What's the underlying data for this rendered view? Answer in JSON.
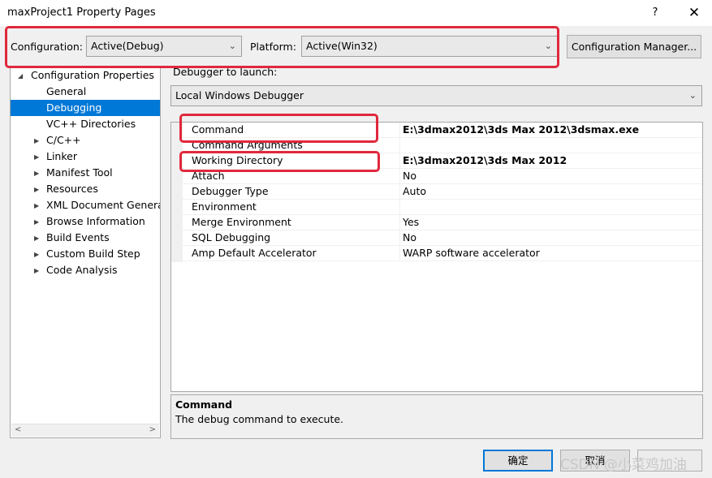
{
  "window": {
    "title": "maxProject1 Property Pages",
    "help_glyph": "?",
    "close_glyph": "✕"
  },
  "toolbar": {
    "configuration_label": "Configuration:",
    "configuration_value": "Active(Debug)",
    "platform_label": "Platform:",
    "platform_value": "Active(Win32)",
    "config_manager_label": "Configuration Manager..."
  },
  "tree": {
    "root_label": "Configuration Properties",
    "items": [
      {
        "label": "General",
        "expandable": false,
        "selected": false
      },
      {
        "label": "Debugging",
        "expandable": false,
        "selected": true
      },
      {
        "label": "VC++ Directories",
        "expandable": false,
        "selected": false
      },
      {
        "label": "C/C++",
        "expandable": true,
        "selected": false
      },
      {
        "label": "Linker",
        "expandable": true,
        "selected": false
      },
      {
        "label": "Manifest Tool",
        "expandable": true,
        "selected": false
      },
      {
        "label": "Resources",
        "expandable": true,
        "selected": false
      },
      {
        "label": "XML Document Generat",
        "expandable": true,
        "selected": false
      },
      {
        "label": "Browse Information",
        "expandable": true,
        "selected": false
      },
      {
        "label": "Build Events",
        "expandable": true,
        "selected": false
      },
      {
        "label": "Custom Build Step",
        "expandable": true,
        "selected": false
      },
      {
        "label": "Code Analysis",
        "expandable": true,
        "selected": false
      }
    ]
  },
  "debugger": {
    "launch_label": "Debugger to launch:",
    "launch_value": "Local Windows Debugger"
  },
  "properties": [
    {
      "name": "Command",
      "value": "E:\\3dmax2012\\3ds Max 2012\\3dsmax.exe",
      "bold": true
    },
    {
      "name": "Command Arguments",
      "value": "",
      "bold": false
    },
    {
      "name": "Working Directory",
      "value": "E:\\3dmax2012\\3ds Max 2012",
      "bold": true
    },
    {
      "name": "Attach",
      "value": "No",
      "bold": false
    },
    {
      "name": "Debugger Type",
      "value": "Auto",
      "bold": false
    },
    {
      "name": "Environment",
      "value": "",
      "bold": false
    },
    {
      "name": "Merge Environment",
      "value": "Yes",
      "bold": false
    },
    {
      "name": "SQL Debugging",
      "value": "No",
      "bold": false
    },
    {
      "name": "Amp Default Accelerator",
      "value": "WARP software accelerator",
      "bold": false
    }
  ],
  "description": {
    "title": "Command",
    "text": "The debug command to execute."
  },
  "footer": {
    "ok_label": "确定",
    "cancel_label": "取消",
    "watermark": "CSDN @小菜鸡加油"
  },
  "colors": {
    "selection": "#0078d7",
    "highlight_box": "#e0283c"
  }
}
